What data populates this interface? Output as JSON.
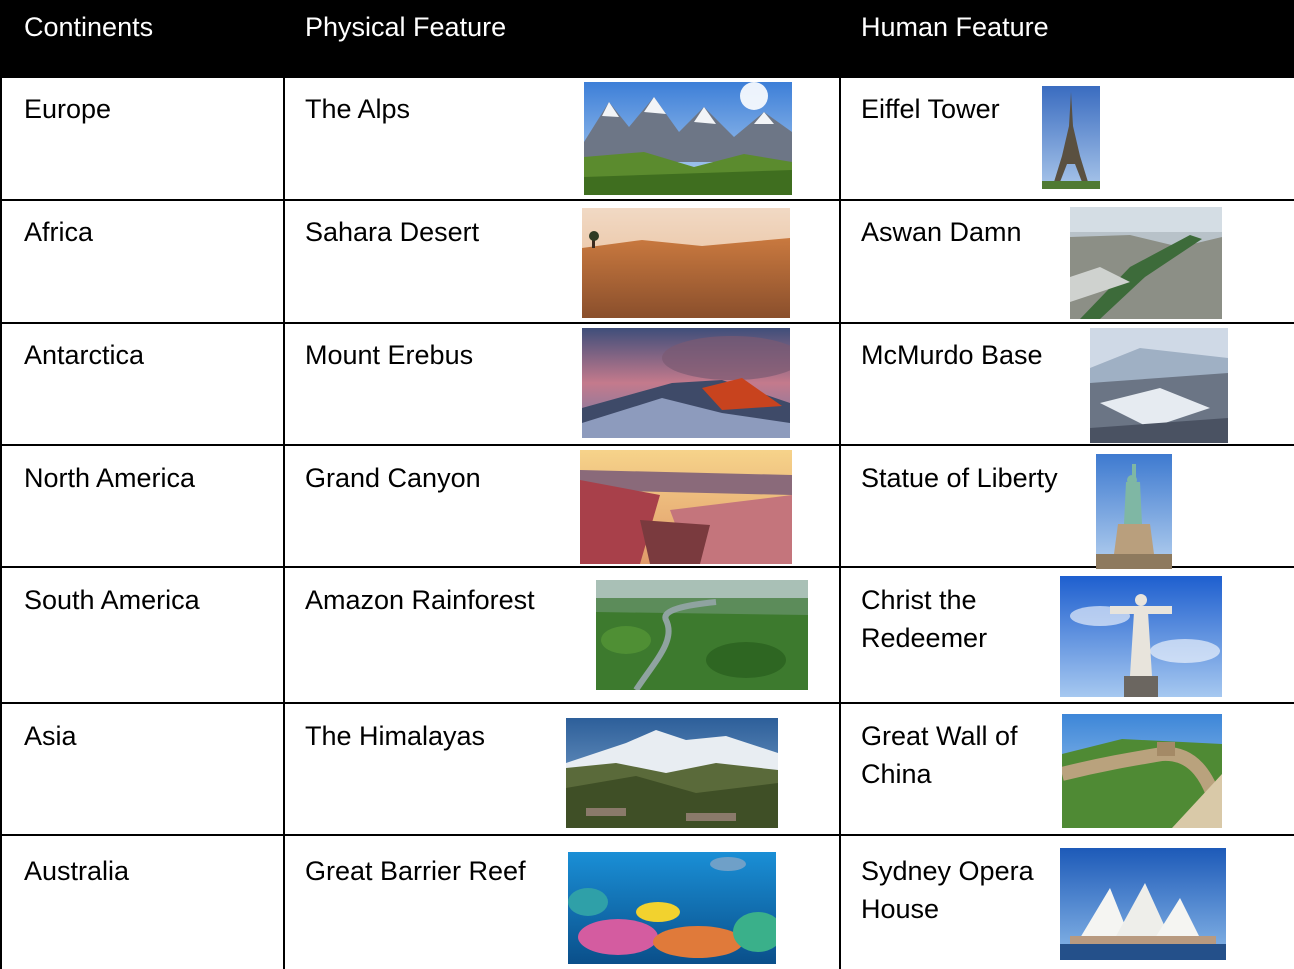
{
  "header": {
    "continents": "Continents",
    "physical": "Physical Feature",
    "human": "Human Feature"
  },
  "rows": [
    {
      "continent": "Europe",
      "physical": "The Alps",
      "human": "Eiffel Tower"
    },
    {
      "continent": "Africa",
      "physical": "Sahara Desert",
      "human": "Aswan Damn"
    },
    {
      "continent": "Antarctica",
      "physical": "Mount Erebus",
      "human": "McMurdo Base"
    },
    {
      "continent": "North America",
      "physical": "Grand Canyon",
      "human": "Statue of Liberty"
    },
    {
      "continent": "South America",
      "physical": "Amazon Rainforest",
      "human": "Christ the\nRedeemer"
    },
    {
      "continent": "Asia",
      "physical": "The Himalayas",
      "human": "Great Wall of\n China"
    },
    {
      "continent": "Australia",
      "physical": "Great Barrier Reef",
      "human": "Sydney Opera\nHouse"
    }
  ]
}
